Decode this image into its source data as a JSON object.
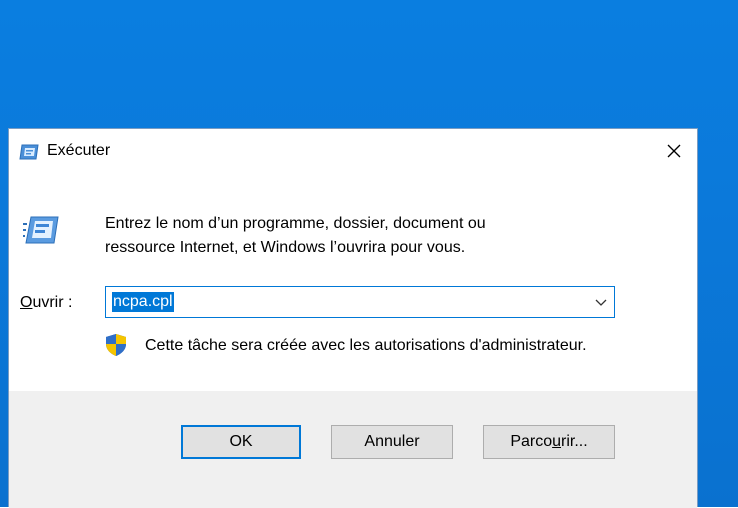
{
  "dialog": {
    "title": "Exécuter",
    "description_line1": "Entrez le nom d’un programme, dossier, document ou",
    "description_line2": "ressource Internet, et Windows l’ouvrira pour vous.",
    "open_label_prefix": "",
    "open_label_accel": "O",
    "open_label_rest": "uvrir :",
    "input_value": "ncpa.cpl",
    "admin_note": "Cette tâche sera créée avec les autorisations d'administrateur.",
    "buttons": {
      "ok": "OK",
      "cancel": "Annuler",
      "browse_before": "Parco",
      "browse_accel": "u",
      "browse_after": "rir..."
    }
  },
  "colors": {
    "desktop": "#0a78d9",
    "accent": "#0078d7",
    "footer_bg": "#f0f0f0"
  },
  "icons": [
    "run-icon",
    "close-icon",
    "run-large-icon",
    "chevron-down-icon",
    "uac-shield-icon"
  ]
}
